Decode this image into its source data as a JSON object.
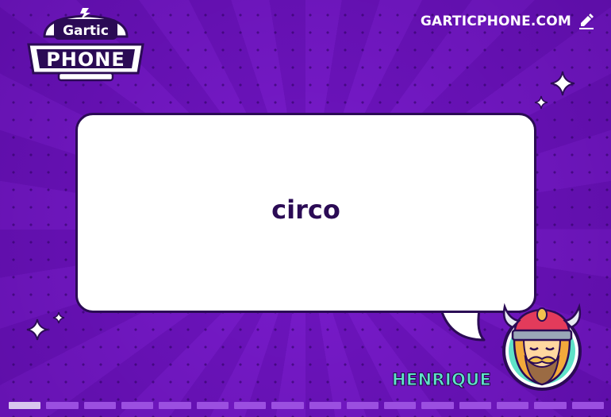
{
  "logo": {
    "top_word": "Gartic",
    "main_word": "PHONE"
  },
  "site": {
    "label": "GARTICPHONE.COM",
    "icon": "pencil-icon"
  },
  "card": {
    "text": "circo"
  },
  "player": {
    "name": "HENRIQUE",
    "avatar": "viking-avatar-icon"
  },
  "progress": {
    "total_segments": 16,
    "completed_segments": 1
  },
  "colors": {
    "background": "#7317c4",
    "bubble": "#ffffff",
    "bubble_text": "#2b0b55",
    "player_name": "#5fe2c8",
    "progress_done": "#d8c6ee",
    "progress_pending": "#9b4fe0"
  }
}
